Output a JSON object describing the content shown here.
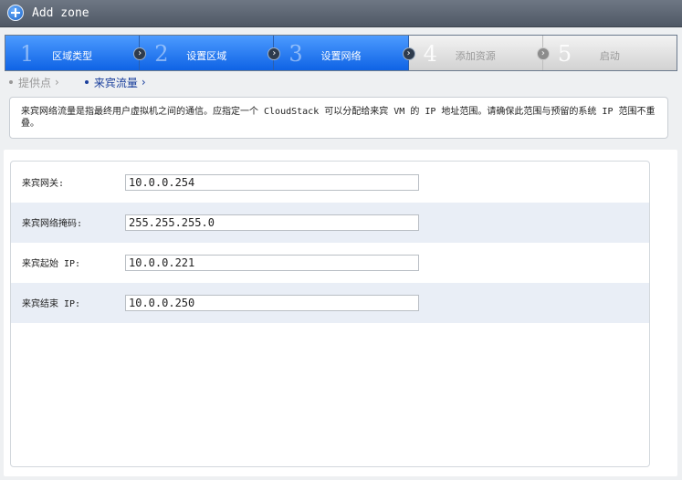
{
  "window": {
    "title": "Add zone"
  },
  "steps": [
    {
      "num": "1",
      "label": "区域类型",
      "active": true
    },
    {
      "num": "2",
      "label": "设置区域",
      "active": true
    },
    {
      "num": "3",
      "label": "设置网络",
      "active": true
    },
    {
      "num": "4",
      "label": "添加资源",
      "active": false
    },
    {
      "num": "5",
      "label": "启动",
      "active": false
    }
  ],
  "breadcrumb": [
    {
      "label": "提供点",
      "chevron": "›"
    },
    {
      "label": "来宾流量",
      "chevron": "›"
    }
  ],
  "description": "来宾网络流量是指最终用户虚拟机之间的通信。应指定一个 CloudStack 可以分配给来宾 VM 的 IP 地址范围。请确保此范围与预留的系统 IP 范围不重叠。",
  "form": {
    "fields": [
      {
        "label": "来宾网关:",
        "value": "10.0.0.254"
      },
      {
        "label": "来宾网络掩码:",
        "value": "255.255.255.0"
      },
      {
        "label": "来宾起始 IP:",
        "value": "10.0.0.221"
      },
      {
        "label": "来宾结束 IP:",
        "value": "10.0.0.250"
      }
    ]
  }
}
